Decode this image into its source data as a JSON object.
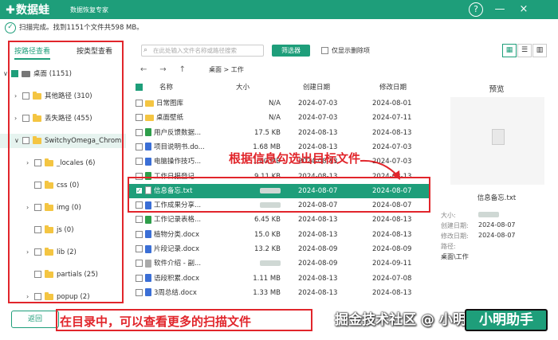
{
  "app": {
    "name": "数据蛙",
    "subtitle": "数据恢复专家"
  },
  "titlebar": {
    "help": "?",
    "min": "—",
    "close": "×"
  },
  "status": {
    "text": "扫描完成。找到1151个文件共598 MB。"
  },
  "tabs": [
    {
      "label": "按路径查看"
    },
    {
      "label": "按类型查看"
    }
  ],
  "tree": [
    {
      "label": "桌面 (1151)"
    },
    {
      "label": "其他路径 (310)"
    },
    {
      "label": "丢失路径 (455)"
    },
    {
      "label": "SwitchyOmega_Chrom"
    },
    {
      "label": "_locales (6)"
    },
    {
      "label": "css (0)"
    },
    {
      "label": "img (0)"
    },
    {
      "label": "js (0)"
    },
    {
      "label": "lib (2)"
    },
    {
      "label": "partials (25)"
    },
    {
      "label": "popup (2)"
    }
  ],
  "toolbar": {
    "search_placeholder": "在此处输入文件名称或路径搜索",
    "filter_label": "筛选器",
    "deleted_only_label": "仅显示删除项"
  },
  "breadcrumb": "桌面 > 工作",
  "table": {
    "headers": [
      "名称",
      "大小",
      "创建日期",
      "修改日期"
    ],
    "rows": [
      {
        "name": "日常图库",
        "size": "N/A",
        "created": "2024-07-03",
        "modified": "2024-08-01"
      },
      {
        "name": "桌面壁纸",
        "size": "N/A",
        "created": "2024-07-03",
        "modified": "2024-07-11"
      },
      {
        "name": "用户反馈数据...",
        "size": "17.5 KB",
        "created": "2024-08-13",
        "modified": "2024-08-13"
      },
      {
        "name": "项目说明书.do...",
        "size": "1.68 MB",
        "created": "2024-08-13",
        "modified": "2024-07-03"
      },
      {
        "name": "电脑操作技巧...",
        "size": "1.40 MB",
        "created": "2024-08-13",
        "modified": "2024-07-03"
      },
      {
        "name": "工作日报登记...",
        "size": "9.11 KB",
        "created": "2024-08-13",
        "modified": "2024-08-13"
      },
      {
        "name": "信息备忘.txt",
        "size": "",
        "created": "2024-08-07",
        "modified": "2024-08-07"
      },
      {
        "name": "工作成果分享...",
        "size": "",
        "created": "2024-08-07",
        "modified": "2024-08-07"
      },
      {
        "name": "工作记录表格...",
        "size": "6.45 KB",
        "created": "2024-08-13",
        "modified": "2024-08-13"
      },
      {
        "name": "植物分类.docx",
        "size": "15.0 KB",
        "created": "2024-08-13",
        "modified": "2024-08-13"
      },
      {
        "name": "片段记录.docx",
        "size": "13.2 KB",
        "created": "2024-08-09",
        "modified": "2024-08-09"
      },
      {
        "name": "软件介绍 - 副...",
        "size": "",
        "created": "2024-08-09",
        "modified": "2024-09-11"
      },
      {
        "name": "语段积累.docx",
        "size": "1.11 MB",
        "created": "2024-08-13",
        "modified": "2024-07-08"
      },
      {
        "name": "3周总结.docx",
        "size": "1.33 MB",
        "created": "2024-08-13",
        "modified": "2024-08-13"
      }
    ]
  },
  "preview": {
    "title": "预览",
    "filename": "信息备忘.txt",
    "size_label": "大小:",
    "created_label": "创建日期:",
    "created": "2024-08-07",
    "modified_label": "修改日期:",
    "modified": "2024-08-07",
    "path_label": "路径:",
    "path": "桌面\\工作"
  },
  "annotations": {
    "top": "根据信息勾选出目标文件",
    "bottom": "在目录中，可以查看更多的扫描文件"
  },
  "footer": {
    "back_label": "返回",
    "watermark": "掘金技术社区 @ 小明助手",
    "next_label": "小明助手"
  }
}
